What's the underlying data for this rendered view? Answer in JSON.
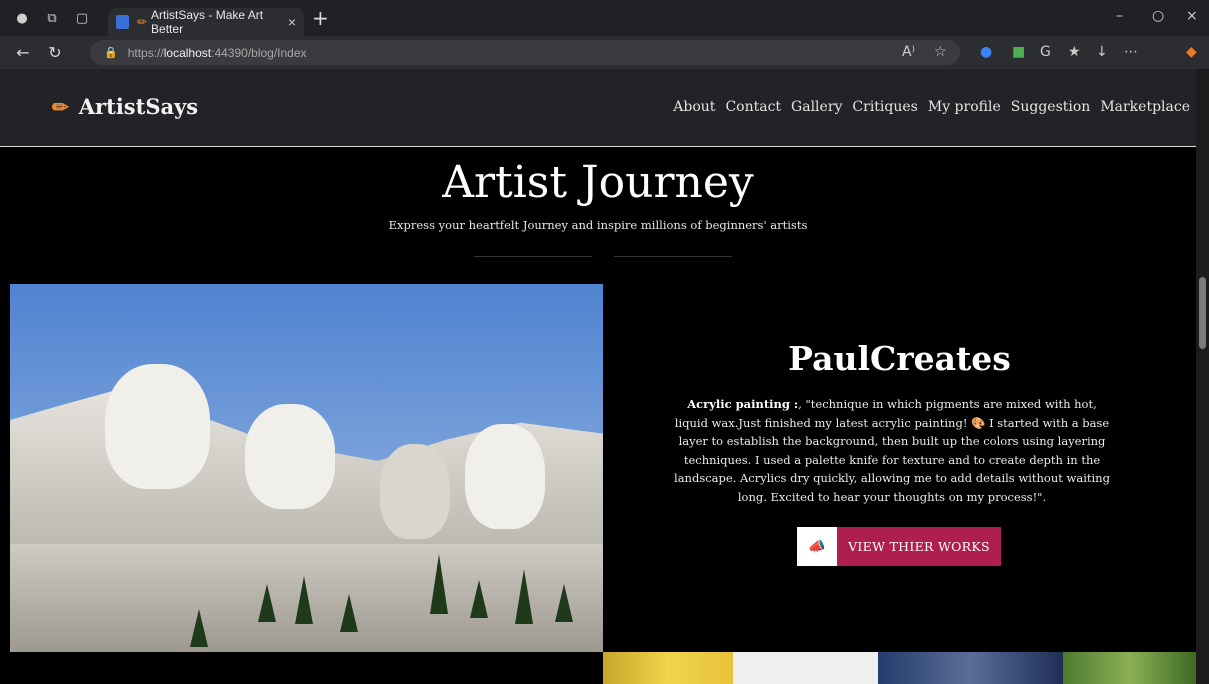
{
  "browser": {
    "tab_title": "ArtistSays - Make Art Better",
    "url_prefix": "https://",
    "url_host": "localhost",
    "url_path": ":44390/blog/Index"
  },
  "navbar": {
    "brand": "ArtistSays",
    "links": [
      "About",
      "Contact",
      "Gallery",
      "Critiques",
      "My profile",
      "Suggestion",
      "Marketplace"
    ]
  },
  "hero": {
    "title": "Artist Journey",
    "subtitle": "Express your heartfelt Journey and inspire millions of beginners' artists"
  },
  "post": {
    "artist_name": "PaulCreates",
    "category_label": "Acrylic painting :",
    "body": ", \"technique in which pigments are mixed with hot, liquid wax.Just finished my latest acrylic painting! 🎨 I started with a base layer to establish the background, then built up the colors using layering techniques. I used a palette knife for texture and to create depth in the landscape. Acrylics dry quickly, allowing me to add details without waiting long. Excited to hear your thoughts on my process!\".",
    "button_label": "VIEW THIER WORKS"
  },
  "colors": {
    "accent": "#ae1f4f",
    "brand_icon": "#f08a2c",
    "navbar_bg": "#222327"
  }
}
